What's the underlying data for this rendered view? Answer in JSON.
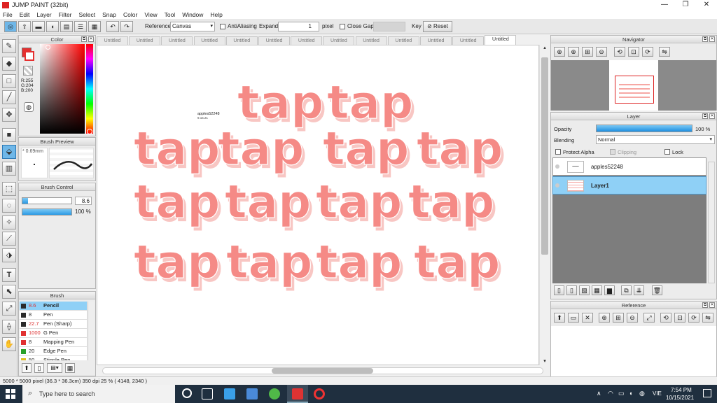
{
  "window": {
    "title": "JUMP PAINT (32bit)",
    "minimize": "—",
    "maximize": "❐",
    "close": "✕"
  },
  "menu": [
    "File",
    "Edit",
    "Layer",
    "Filter",
    "Select",
    "Snap",
    "Color",
    "View",
    "Tool",
    "Window",
    "Help"
  ],
  "toolbar": {
    "reference_label": "Reference",
    "reference_value": "Canvas",
    "antialiasing_label": "AntiAliasing",
    "expand_label": "Expand",
    "expand_value": "1",
    "expand_unit": "pixel",
    "close_gaps_label": "Close Gaps",
    "key_label": "Key",
    "reset_label": "Reset"
  },
  "color_panel": {
    "title": "Color",
    "r": "R:255",
    "g": "G:204",
    "b": "B:200",
    "primary": "#ffccc8",
    "secondary": "#ffffff"
  },
  "brush_preview": {
    "title": "Brush Preview",
    "size": "* 0.69mm"
  },
  "brush_control": {
    "title": "Brush Control",
    "size_value": "8.6",
    "opacity_value": "100 %",
    "size_fraction": 0.12,
    "opacity_fraction": 1.0
  },
  "brush_list": {
    "title": "Brush",
    "items": [
      {
        "size": "8.6",
        "name": "Pencil",
        "color": "#2b2b2b",
        "selected": true
      },
      {
        "size": "8",
        "name": "Pen",
        "color": "#2b2b2b",
        "selected": false
      },
      {
        "size": "22.7",
        "name": "Pen (Sharp)",
        "color": "#2b2b2b",
        "selected": false
      },
      {
        "size": "1000",
        "name": "G Pen",
        "color": "#e03030",
        "selected": false
      },
      {
        "size": "8",
        "name": "Mapping Pen",
        "color": "#e03030",
        "selected": false
      },
      {
        "size": "20",
        "name": "Edge Pen",
        "color": "#2aa02a",
        "selected": false
      },
      {
        "size": "50",
        "name": "Stipple Pen",
        "color": "#e0c020",
        "selected": false
      }
    ]
  },
  "tabs": [
    "Untitled",
    "Untitled",
    "Untitled",
    "Untitled",
    "Untitled",
    "Untitled",
    "Untitled",
    "Untitled",
    "Untitled",
    "Untitled",
    "Untitled",
    "Untitled",
    "Untitled"
  ],
  "canvas": {
    "signature": "apples52248",
    "signature_small": "9.15.21",
    "rows": [
      [
        "tap",
        "tap"
      ],
      [
        "tap",
        "tap",
        "tap",
        "tap"
      ],
      [
        "tap",
        "tap",
        "tap",
        "tap"
      ],
      [
        "tap",
        "tap",
        "tap",
        "tap"
      ]
    ],
    "ink_color": "#f58a86",
    "shadow_color": "#f8c6c3"
  },
  "navigator": {
    "title": "Navigator"
  },
  "layer_panel": {
    "title": "Layer",
    "opacity_label": "Opacity",
    "opacity_value": "100 %",
    "opacity_fraction": 1.0,
    "blending_label": "Blending",
    "blending_value": "Normal",
    "protect_alpha_label": "Protect Alpha",
    "clipping_label": "Clipping",
    "lock_label": "Lock",
    "layers": [
      {
        "name": "apples52248",
        "selected": false
      },
      {
        "name": "Layer1",
        "selected": true
      }
    ]
  },
  "reference_panel": {
    "title": "Reference"
  },
  "status": {
    "size": "5000 * 5000 pixel",
    "physical": "(36.3 * 36.3cm)",
    "dpi": "350 dpi",
    "zoom": "25 %",
    "coords": "( 4148, 2340 )"
  },
  "taskbar": {
    "search_placeholder": "Type here to search",
    "lang": "VIE",
    "time": "7:54 PM",
    "date": "10/15/2021"
  }
}
